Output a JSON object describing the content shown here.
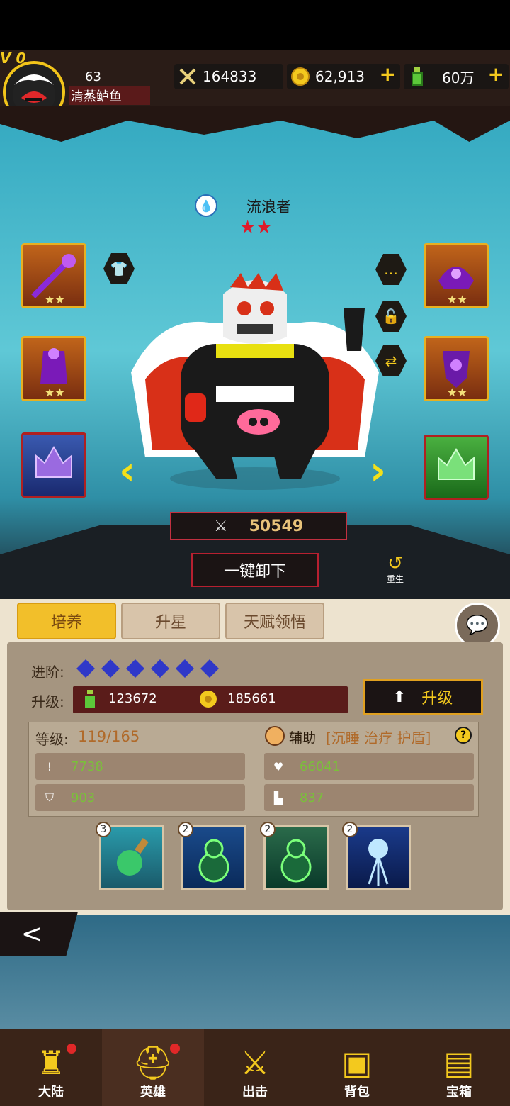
{
  "player": {
    "vip": "V 0",
    "level": "63",
    "name": "清蒸鲈鱼"
  },
  "resources": {
    "power": "164833",
    "gold": "62,913",
    "potion": "60万"
  },
  "hero": {
    "name": "流浪者",
    "stars": "★★",
    "power": "50549",
    "unequip_label": "一键卸下",
    "rebirth_label": "重生"
  },
  "equip_slots": {
    "left": [
      "weapon-slot",
      "armor-slot",
      "relic-slot-purple"
    ],
    "right": [
      "helmet-slot",
      "boots-slot",
      "relic-slot-green"
    ],
    "stars": "★★"
  },
  "tabs": [
    "培养",
    "升星",
    "天赋领悟"
  ],
  "train": {
    "advance_label": "进阶:",
    "upgrade_label": "升级:",
    "upgrade_potion_cost": "123672",
    "upgrade_gold_cost": "185661",
    "upgrade_button": "升级",
    "level_label": "等级:",
    "level_value": "119/165",
    "role_label": "辅助",
    "role_tags": "[沉睡 治疗 护盾]",
    "stats": {
      "attack": "7738",
      "hp": "66041",
      "defense": "903",
      "speed": "837"
    },
    "gems_count": 6
  },
  "skills": [
    {
      "badge": "3",
      "icon": "potion-skill-icon"
    },
    {
      "badge": "2",
      "icon": "gourd-skill-icon"
    },
    {
      "badge": "2",
      "icon": "gourd-skill-icon"
    },
    {
      "badge": "2",
      "icon": "lightning-skill-icon"
    }
  ],
  "nav": [
    {
      "label": "大陆",
      "icon": "castle-icon",
      "dot": true
    },
    {
      "label": "英雄",
      "icon": "helmet-icon",
      "dot": true
    },
    {
      "label": "出击",
      "icon": "crossed-swords-icon",
      "dot": false
    },
    {
      "label": "背包",
      "icon": "backpack-icon",
      "dot": false
    },
    {
      "label": "宝箱",
      "icon": "chest-icon",
      "dot": false
    }
  ],
  "colors": {
    "accent": "#f3c91e",
    "panel": "#ede3cf",
    "danger": "#e0192a"
  }
}
